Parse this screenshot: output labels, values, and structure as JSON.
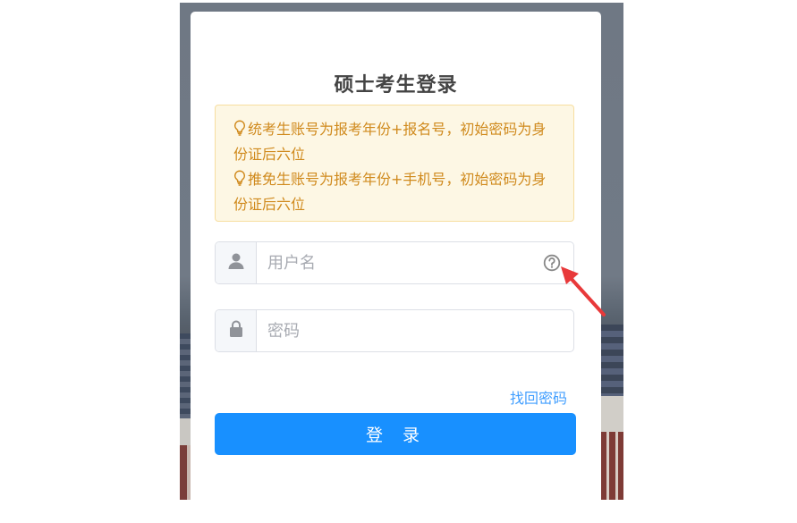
{
  "page": {
    "title": "硕士考生登录"
  },
  "notice": {
    "line1": "统考生账号为报考年份+报名号，初始密码为身份证后六位",
    "line2": "推免生账号为报考年份+手机号，初始密码为身份证后六位"
  },
  "form": {
    "username_placeholder": "用户名",
    "password_placeholder": "密码",
    "forgot_password": "找回密码",
    "login_button": "登 录"
  },
  "colors": {
    "accent": "#1890ff",
    "link": "#409eff",
    "notice_text": "#d08a1d",
    "notice_bg": "#fdf7e4",
    "annotation_arrow": "#e8393a"
  },
  "icons": {
    "user": "user-icon",
    "lock": "lock-icon",
    "help": "question-circle-icon",
    "bulb": "lightbulb-icon"
  }
}
